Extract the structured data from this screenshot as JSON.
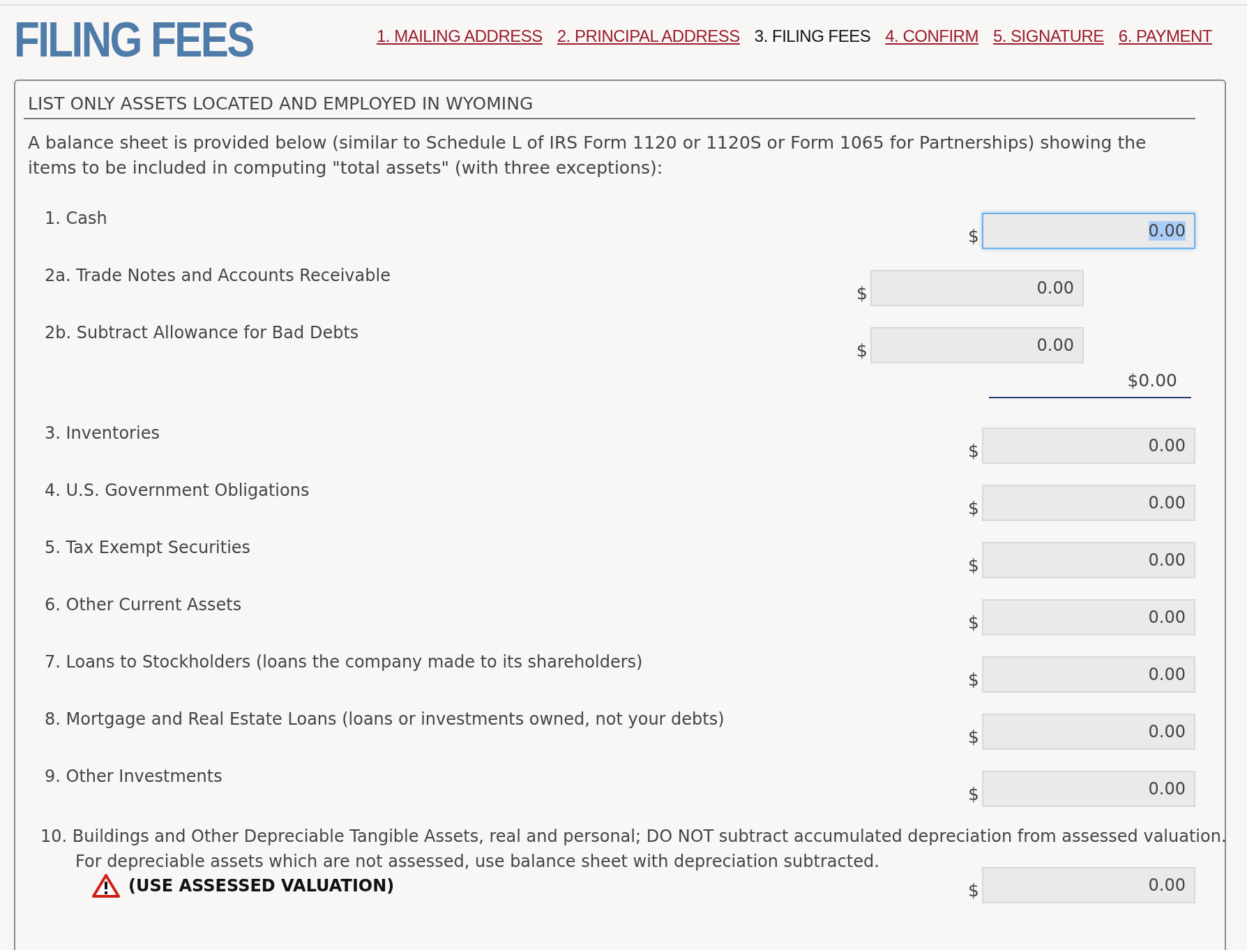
{
  "page_title": "FILING FEES",
  "steps": [
    {
      "label": "1. MAILING ADDRESS",
      "selected": false
    },
    {
      "label": "2. PRINCIPAL ADDRESS",
      "selected": false
    },
    {
      "label": "3. FILING FEES",
      "selected": true
    },
    {
      "label": "4. CONFIRM",
      "selected": false
    },
    {
      "label": "5. SIGNATURE",
      "selected": false
    },
    {
      "label": "6. PAYMENT",
      "selected": false
    }
  ],
  "panel": {
    "heading": "LIST ONLY ASSETS LOCATED AND EMPLOYED IN WYOMING",
    "intro": "A balance sheet is provided below (similar to Schedule L of IRS Form 1120 or 1120S or Form 1065 for Partnerships) showing the items to be included in computing \"total assets\" (with three exceptions):",
    "rows": [
      {
        "kind": "main",
        "label": "1. Cash",
        "currency": "$",
        "value": "0.00",
        "focused": true
      },
      {
        "kind": "sub",
        "label": "2a. Trade Notes and Accounts Receivable",
        "currency": "$",
        "value": "0.00",
        "focused": false
      },
      {
        "kind": "sub",
        "label": "2b. Subtract Allowance for Bad Debts",
        "currency": "$",
        "value": "0.00",
        "focused": false
      },
      {
        "kind": "subtotal",
        "value": "$0.00"
      },
      {
        "kind": "main",
        "label": "3. Inventories",
        "currency": "$",
        "value": "0.00",
        "focused": false
      },
      {
        "kind": "main",
        "label": "4. U.S. Government Obligations",
        "currency": "$",
        "value": "0.00",
        "focused": false
      },
      {
        "kind": "main",
        "label": "5. Tax Exempt Securities",
        "currency": "$",
        "value": "0.00",
        "focused": false
      },
      {
        "kind": "main",
        "label": "6. Other Current Assets",
        "currency": "$",
        "value": "0.00",
        "focused": false
      },
      {
        "kind": "main",
        "label": "7. Loans to Stockholders (loans the company made to its shareholders)",
        "currency": "$",
        "value": "0.00",
        "focused": false
      },
      {
        "kind": "main",
        "label": "8. Mortgage and Real Estate Loans (loans or investments owned, not your debts)",
        "currency": "$",
        "value": "0.00",
        "focused": false
      },
      {
        "kind": "main",
        "label": "9. Other Investments",
        "currency": "$",
        "value": "0.00",
        "focused": false
      },
      {
        "kind": "main",
        "label": "10. Buildings and Other Depreciable Tangible Assets, real and personal; DO NOT subtract accumulated depreciation from assessed valuation.  For depreciable assets which are not assessed, use balance sheet with depreciation subtracted.",
        "currency": "$",
        "value": "0.00",
        "focused": false,
        "warning": "(USE ASSESSED VALUATION)"
      }
    ]
  }
}
